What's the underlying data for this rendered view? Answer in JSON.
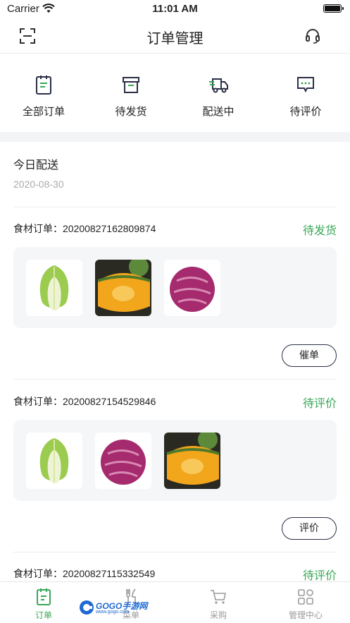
{
  "status_bar": {
    "carrier": "Carrier",
    "time": "11:01 AM"
  },
  "header": {
    "title": "订单管理",
    "left_icon": "scan-icon",
    "right_icon": "headset-icon"
  },
  "order_tabs": [
    {
      "label": "全部订单",
      "icon": "clipboard-icon"
    },
    {
      "label": "待发货",
      "icon": "box-icon"
    },
    {
      "label": "配送中",
      "icon": "truck-icon"
    },
    {
      "label": "待评价",
      "icon": "chat-icon"
    }
  ],
  "section": {
    "title": "今日配送",
    "date": "2020-08-30"
  },
  "orders": [
    {
      "label": "食材订单：20200827162809874",
      "status": "待发货",
      "items": [
        "cabbage",
        "pumpkin",
        "red-cabbage"
      ],
      "action": "催单"
    },
    {
      "label": "食材订单：20200827154529846",
      "status": "待评价",
      "items": [
        "cabbage",
        "red-cabbage",
        "pumpkin"
      ],
      "action": "评价"
    },
    {
      "label": "食材订单：20200827115332549",
      "status": "待评价"
    }
  ],
  "bottom_nav": [
    {
      "label": "订单",
      "icon": "order-icon",
      "active": true
    },
    {
      "label": "菜单",
      "icon": "cutlery-icon",
      "active": false
    },
    {
      "label": "采购",
      "icon": "cart-icon",
      "active": false
    },
    {
      "label": "管理中心",
      "icon": "grid-icon",
      "active": false
    }
  ],
  "watermark": {
    "text": "GOGO手游网",
    "sub": "www.gogo.com"
  },
  "colors": {
    "accent": "#3aa757",
    "dark": "#2a2f45",
    "muted": "#9a9a9a"
  }
}
